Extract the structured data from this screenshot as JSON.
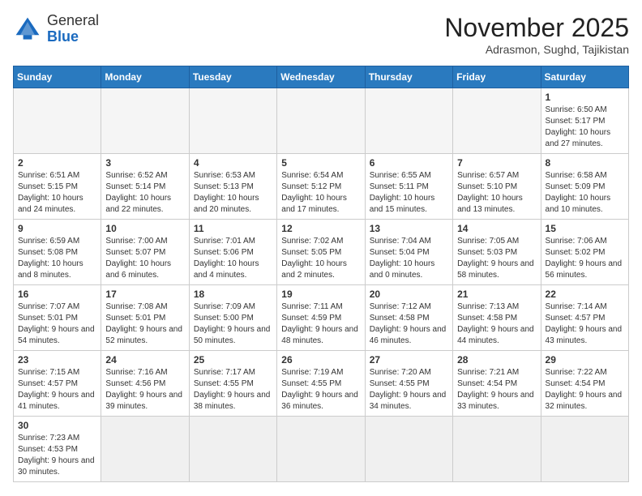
{
  "header": {
    "logo_general": "General",
    "logo_blue": "Blue",
    "month_title": "November 2025",
    "location": "Adrasmon, Sughd, Tajikistan"
  },
  "weekdays": [
    "Sunday",
    "Monday",
    "Tuesday",
    "Wednesday",
    "Thursday",
    "Friday",
    "Saturday"
  ],
  "weeks": [
    [
      {
        "day": "",
        "info": ""
      },
      {
        "day": "",
        "info": ""
      },
      {
        "day": "",
        "info": ""
      },
      {
        "day": "",
        "info": ""
      },
      {
        "day": "",
        "info": ""
      },
      {
        "day": "",
        "info": ""
      },
      {
        "day": "1",
        "info": "Sunrise: 6:50 AM\nSunset: 5:17 PM\nDaylight: 10 hours and 27 minutes."
      }
    ],
    [
      {
        "day": "2",
        "info": "Sunrise: 6:51 AM\nSunset: 5:15 PM\nDaylight: 10 hours and 24 minutes."
      },
      {
        "day": "3",
        "info": "Sunrise: 6:52 AM\nSunset: 5:14 PM\nDaylight: 10 hours and 22 minutes."
      },
      {
        "day": "4",
        "info": "Sunrise: 6:53 AM\nSunset: 5:13 PM\nDaylight: 10 hours and 20 minutes."
      },
      {
        "day": "5",
        "info": "Sunrise: 6:54 AM\nSunset: 5:12 PM\nDaylight: 10 hours and 17 minutes."
      },
      {
        "day": "6",
        "info": "Sunrise: 6:55 AM\nSunset: 5:11 PM\nDaylight: 10 hours and 15 minutes."
      },
      {
        "day": "7",
        "info": "Sunrise: 6:57 AM\nSunset: 5:10 PM\nDaylight: 10 hours and 13 minutes."
      },
      {
        "day": "8",
        "info": "Sunrise: 6:58 AM\nSunset: 5:09 PM\nDaylight: 10 hours and 10 minutes."
      }
    ],
    [
      {
        "day": "9",
        "info": "Sunrise: 6:59 AM\nSunset: 5:08 PM\nDaylight: 10 hours and 8 minutes."
      },
      {
        "day": "10",
        "info": "Sunrise: 7:00 AM\nSunset: 5:07 PM\nDaylight: 10 hours and 6 minutes."
      },
      {
        "day": "11",
        "info": "Sunrise: 7:01 AM\nSunset: 5:06 PM\nDaylight: 10 hours and 4 minutes."
      },
      {
        "day": "12",
        "info": "Sunrise: 7:02 AM\nSunset: 5:05 PM\nDaylight: 10 hours and 2 minutes."
      },
      {
        "day": "13",
        "info": "Sunrise: 7:04 AM\nSunset: 5:04 PM\nDaylight: 10 hours and 0 minutes."
      },
      {
        "day": "14",
        "info": "Sunrise: 7:05 AM\nSunset: 5:03 PM\nDaylight: 9 hours and 58 minutes."
      },
      {
        "day": "15",
        "info": "Sunrise: 7:06 AM\nSunset: 5:02 PM\nDaylight: 9 hours and 56 minutes."
      }
    ],
    [
      {
        "day": "16",
        "info": "Sunrise: 7:07 AM\nSunset: 5:01 PM\nDaylight: 9 hours and 54 minutes."
      },
      {
        "day": "17",
        "info": "Sunrise: 7:08 AM\nSunset: 5:01 PM\nDaylight: 9 hours and 52 minutes."
      },
      {
        "day": "18",
        "info": "Sunrise: 7:09 AM\nSunset: 5:00 PM\nDaylight: 9 hours and 50 minutes."
      },
      {
        "day": "19",
        "info": "Sunrise: 7:11 AM\nSunset: 4:59 PM\nDaylight: 9 hours and 48 minutes."
      },
      {
        "day": "20",
        "info": "Sunrise: 7:12 AM\nSunset: 4:58 PM\nDaylight: 9 hours and 46 minutes."
      },
      {
        "day": "21",
        "info": "Sunrise: 7:13 AM\nSunset: 4:58 PM\nDaylight: 9 hours and 44 minutes."
      },
      {
        "day": "22",
        "info": "Sunrise: 7:14 AM\nSunset: 4:57 PM\nDaylight: 9 hours and 43 minutes."
      }
    ],
    [
      {
        "day": "23",
        "info": "Sunrise: 7:15 AM\nSunset: 4:57 PM\nDaylight: 9 hours and 41 minutes."
      },
      {
        "day": "24",
        "info": "Sunrise: 7:16 AM\nSunset: 4:56 PM\nDaylight: 9 hours and 39 minutes."
      },
      {
        "day": "25",
        "info": "Sunrise: 7:17 AM\nSunset: 4:55 PM\nDaylight: 9 hours and 38 minutes."
      },
      {
        "day": "26",
        "info": "Sunrise: 7:19 AM\nSunset: 4:55 PM\nDaylight: 9 hours and 36 minutes."
      },
      {
        "day": "27",
        "info": "Sunrise: 7:20 AM\nSunset: 4:55 PM\nDaylight: 9 hours and 34 minutes."
      },
      {
        "day": "28",
        "info": "Sunrise: 7:21 AM\nSunset: 4:54 PM\nDaylight: 9 hours and 33 minutes."
      },
      {
        "day": "29",
        "info": "Sunrise: 7:22 AM\nSunset: 4:54 PM\nDaylight: 9 hours and 32 minutes."
      }
    ],
    [
      {
        "day": "30",
        "info": "Sunrise: 7:23 AM\nSunset: 4:53 PM\nDaylight: 9 hours and 30 minutes."
      },
      {
        "day": "",
        "info": ""
      },
      {
        "day": "",
        "info": ""
      },
      {
        "day": "",
        "info": ""
      },
      {
        "day": "",
        "info": ""
      },
      {
        "day": "",
        "info": ""
      },
      {
        "day": "",
        "info": ""
      }
    ]
  ]
}
